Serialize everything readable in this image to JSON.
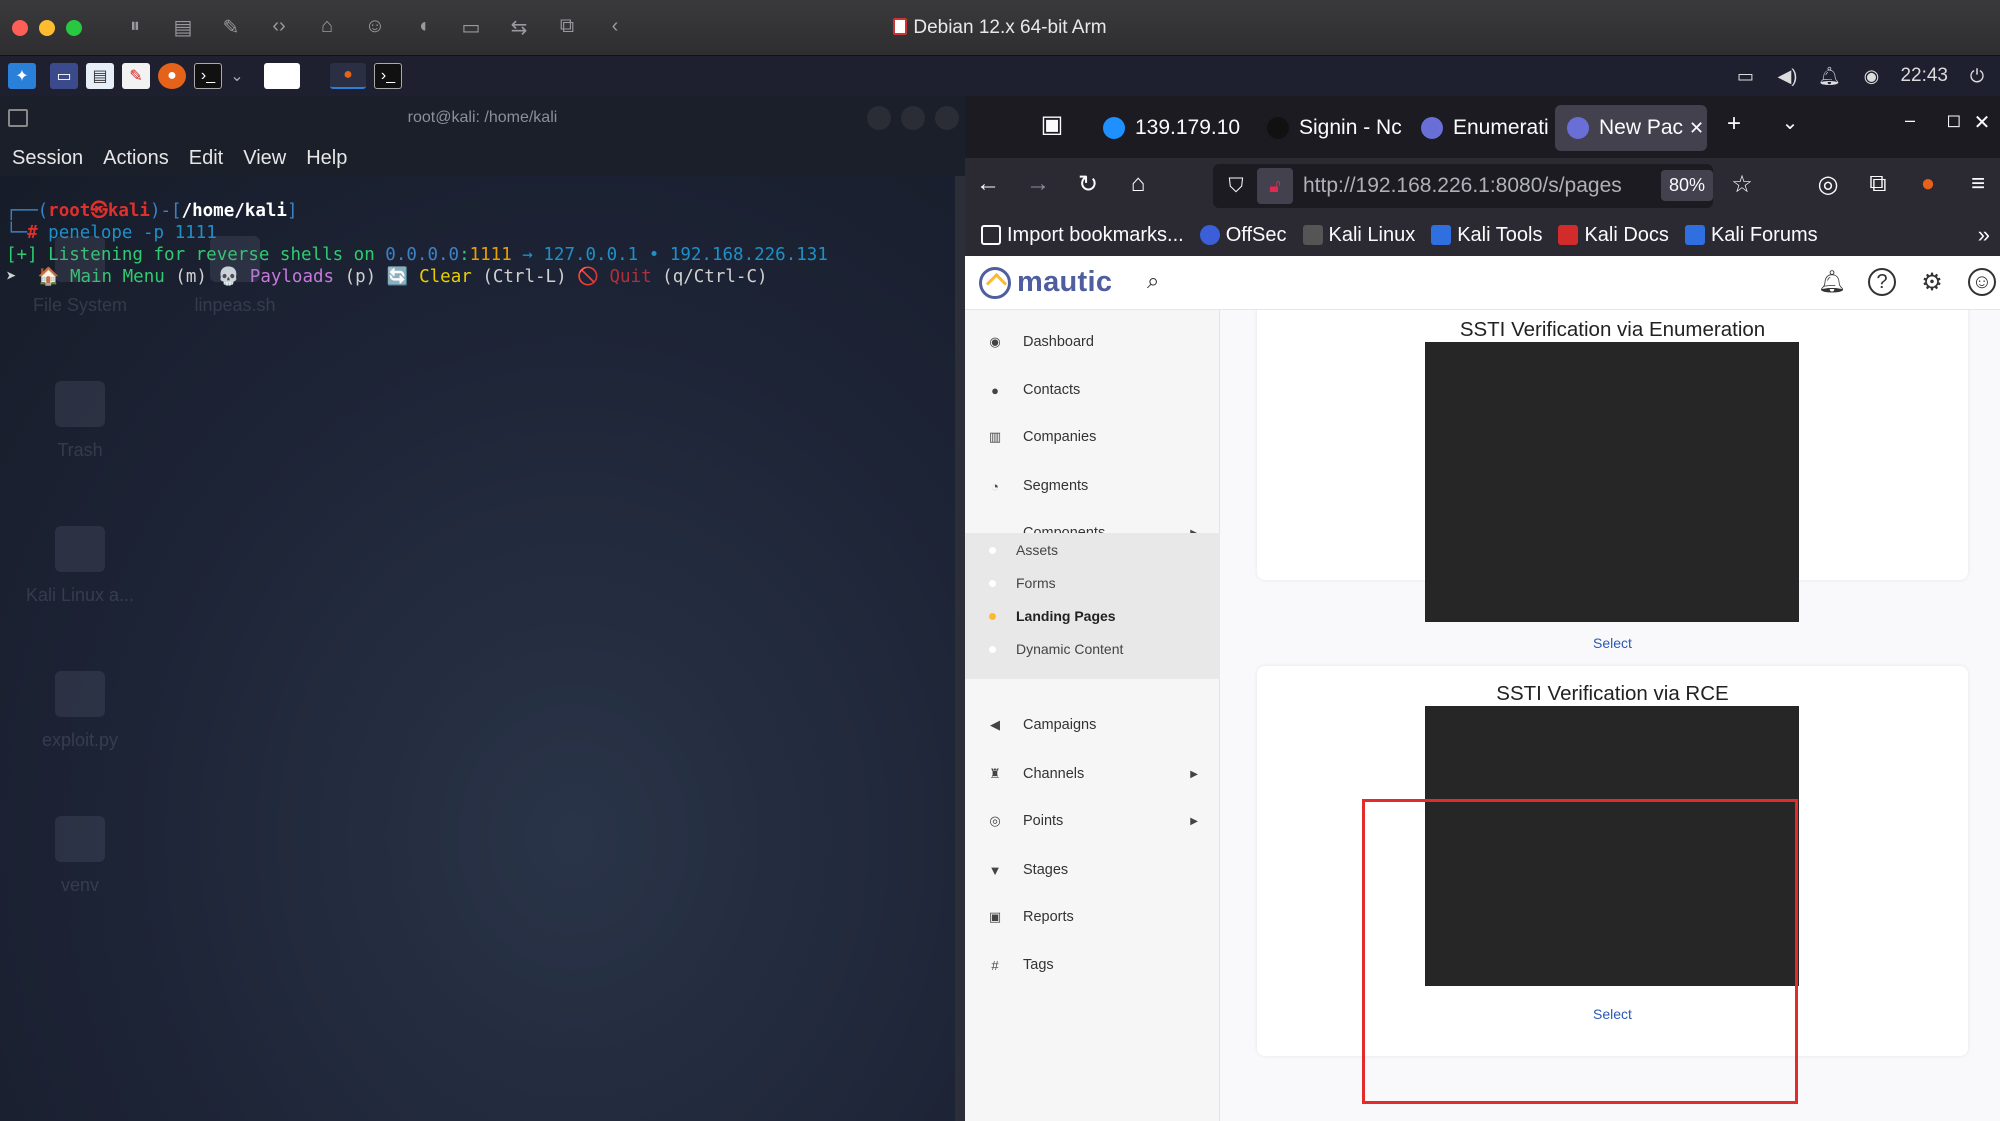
{
  "mac": {
    "title": "Debian 12.x 64-bit Arm",
    "toolbar_icons": [
      "pause-icon",
      "snapshot-icon",
      "wrench-icon",
      "code-icon",
      "drive-icon",
      "user-icon",
      "sound-icon",
      "camera-icon",
      "usb-icon",
      "folder-share-icon",
      "back-icon"
    ]
  },
  "kali_panel": {
    "time": "22:43"
  },
  "terminal": {
    "title": "root@kali: /home/kali",
    "menu": [
      "Session",
      "Actions",
      "Edit",
      "View",
      "Help"
    ],
    "line1": {
      "a": "┌──(",
      "user": "root",
      "at": "㉿",
      "host": "kali",
      "b": ")-[",
      "path": "/home/kali",
      "c": "]"
    },
    "line2": {
      "a": "└─",
      "hash": "#",
      "cmd": " penelope -p 1111"
    },
    "line3": {
      "prefix": "[+] Listening for reverse shells on ",
      "ip1": "0.0.0.0",
      "colon": ":",
      "port": "1111",
      "arrow": " → ",
      "ip2": "127.0.0.1",
      "sep": " • ",
      "ip3": "192.168.226.131"
    },
    "line4": {
      "a": "➤  🏠 ",
      "mainmenu": "Main Menu",
      "m": " (m) 💀 ",
      "payloads": "Payloads",
      "p": " (p) 🔄 ",
      "clear": "Clear",
      "cl": " (Ctrl-L) 🚫 ",
      "quit": "Quit",
      "q": " (q/Ctrl-C)"
    },
    "desktop": [
      "File System",
      "linpeas.sh",
      "Trash",
      "Kali Linux a...",
      "exploit.py",
      "venv"
    ]
  },
  "browser": {
    "tabs": [
      {
        "label": "139.179.10",
        "color": "#1e90ff"
      },
      {
        "label": "Signin - Nc",
        "color": "#222222"
      },
      {
        "label": "Enumerati",
        "color": "#6a6fd8"
      },
      {
        "label": "New Pac",
        "color": "#6a6fd8"
      }
    ],
    "url": "http://192.168.226.1:8080/s/pages",
    "zoom": "80%",
    "bookmarks": [
      {
        "label": "Import bookmarks...",
        "color": "#2b2a33"
      },
      {
        "label": "OffSec",
        "color": "#3a5fd8"
      },
      {
        "label": "Kali Linux",
        "color": "#2b2a33"
      },
      {
        "label": "Kali Tools",
        "color": "#2f6fe0"
      },
      {
        "label": "Kali Docs",
        "color": "#d22b2b"
      },
      {
        "label": "Kali Forums",
        "color": "#2f6fe0"
      }
    ]
  },
  "mautic": {
    "logo": "mautic",
    "sidebar": [
      {
        "label": "Dashboard",
        "icon": "◉"
      },
      {
        "label": "Contacts",
        "icon": "●"
      },
      {
        "label": "Companies",
        "icon": "▥"
      },
      {
        "label": "Segments",
        "icon": "◔"
      },
      {
        "label": "Components",
        "icon": "▬"
      },
      {
        "label": "Campaigns",
        "icon": "◀"
      },
      {
        "label": "Channels",
        "icon": "♜"
      },
      {
        "label": "Points",
        "icon": "◎"
      },
      {
        "label": "Stages",
        "icon": "▼"
      },
      {
        "label": "Reports",
        "icon": "▣"
      },
      {
        "label": "Tags",
        "icon": "#"
      }
    ],
    "components_sub": [
      "Assets",
      "Forms",
      "Landing Pages",
      "Dynamic Content"
    ],
    "cards": [
      {
        "title": "SSTI Verification via Enumeration",
        "select": "Select"
      },
      {
        "title": "SSTI Verification via RCE",
        "select": "Select"
      }
    ]
  }
}
